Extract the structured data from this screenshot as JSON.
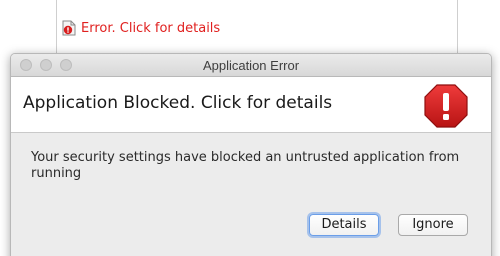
{
  "applet": {
    "error_link": "Error. Click for details",
    "error_color": "#e0201f",
    "icon": "document-error-icon"
  },
  "dialog": {
    "window_title": "Application Error",
    "headline": "Application Blocked. Click for details",
    "message": "Your security settings have blocked an untrusted application from running",
    "icon": "stop-sign-icon",
    "icon_color": "#d81e1e",
    "buttons": {
      "details": "Details",
      "ignore": "Ignore"
    }
  }
}
